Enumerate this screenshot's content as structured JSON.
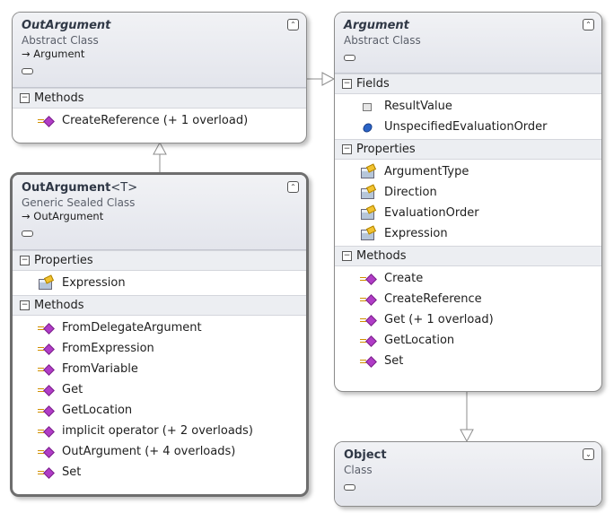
{
  "out_argument": {
    "title": "OutArgument",
    "kind": "Abstract Class",
    "base": "Argument",
    "sections": {
      "methods": {
        "label": "Methods",
        "items": [
          "CreateReference (+ 1 overload)"
        ]
      }
    }
  },
  "argument": {
    "title": "Argument",
    "kind": "Abstract Class",
    "sections": {
      "fields": {
        "label": "Fields",
        "items": [
          "ResultValue",
          "UnspecifiedEvaluationOrder"
        ]
      },
      "properties": {
        "label": "Properties",
        "items": [
          "ArgumentType",
          "Direction",
          "EvaluationOrder",
          "Expression"
        ]
      },
      "methods": {
        "label": "Methods",
        "items": [
          "Create",
          "CreateReference",
          "Get (+ 1 overload)",
          "GetLocation",
          "Set"
        ]
      }
    }
  },
  "out_argument_t": {
    "title": "OutArgument",
    "generic": "<T>",
    "kind": "Generic Sealed Class",
    "base": "OutArgument",
    "sections": {
      "properties": {
        "label": "Properties",
        "items": [
          "Expression"
        ]
      },
      "methods": {
        "label": "Methods",
        "items": [
          "FromDelegateArgument",
          "FromExpression",
          "FromVariable",
          "Get",
          "GetLocation",
          "implicit operator (+ 2 overloads)",
          "OutArgument (+ 4 overloads)",
          "Set"
        ]
      }
    }
  },
  "object": {
    "title": "Object",
    "kind": "Class"
  },
  "glyphs": {
    "collapse": "⌃",
    "expand": "⌄",
    "section_toggle": "−",
    "inherit_arrow": "→"
  },
  "colors": {
    "header_bg": "#e3e5ec",
    "section_bg": "#eceef2",
    "method_icon": "#b03cc6",
    "constant_icon": "#2a63c6"
  }
}
